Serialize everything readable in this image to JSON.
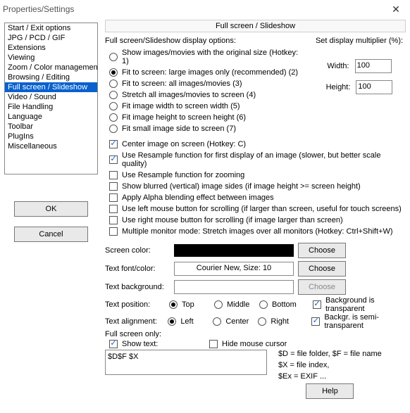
{
  "title": "Properties/Settings",
  "categories": [
    "Start / Exit options",
    "JPG / PCD / GIF",
    "Extensions",
    "Viewing",
    "Zoom / Color management",
    "Browsing / Editing",
    "Full screen / Slideshow",
    "Video / Sound",
    "File Handling",
    "Language",
    "Toolbar",
    "PlugIns",
    "Miscellaneous"
  ],
  "ok_label": "OK",
  "cancel_label": "Cancel",
  "header": "Full screen / Slideshow",
  "display_options_label": "Full screen/Slideshow display options:",
  "radios": {
    "r1": "Show images/movies with the original size (Hotkey: 1)",
    "r2": "Fit to screen: large images only (recommended) (2)",
    "r3": "Fit to screen: all images/movies (3)",
    "r4": "Stretch all images/movies to screen (4)",
    "r5": "Fit image width to screen width (5)",
    "r6": "Fit image height to screen height (6)",
    "r7": "Fit small image side to screen (7)"
  },
  "multiplier": {
    "label": "Set display multiplier (%):",
    "width_label": "Width:",
    "height_label": "Height:",
    "width": "100",
    "height": "100"
  },
  "checks": {
    "center": "Center image on screen (Hotkey: C)",
    "resample_first": "Use Resample function for first display of an image (slower, but better scale quality)",
    "resample_zoom": "Use Resample function for zooming",
    "blurred": "Show blurred (vertical) image sides (if image height >= screen height)",
    "alpha": "Apply Alpha blending effect between images",
    "lmouse": "Use left mouse button for scrolling (if larger than screen, useful for touch screens)",
    "rmouse": "Use right mouse button for scrolling (if image larger than screen)",
    "multimon": "Multiple monitor mode: Stretch images over all monitors (Hotkey: Ctrl+Shift+W)",
    "bg_trans": "Background is transparent",
    "bg_semi": "Backgr. is semi-transparent",
    "show_text": "Show text:",
    "hide_cursor": "Hide mouse cursor"
  },
  "rows": {
    "screen_color": "Screen color:",
    "font_color": "Text font/color:",
    "font_value": "Courier New, Size: 10",
    "text_bg": "Text background:",
    "choose": "Choose",
    "text_pos": "Text position:",
    "text_align": "Text alignment:",
    "full_only": "Full screen only:",
    "top": "Top",
    "middle": "Middle",
    "bottom": "Bottom",
    "left": "Left",
    "center": "Center",
    "right": "Right"
  },
  "textarea_value": "$D$F $X",
  "legend1": "$D = file folder, $F = file name",
  "legend2": "$X = file index,",
  "legend3": "$Ex = EXIF ...",
  "help": "Help"
}
